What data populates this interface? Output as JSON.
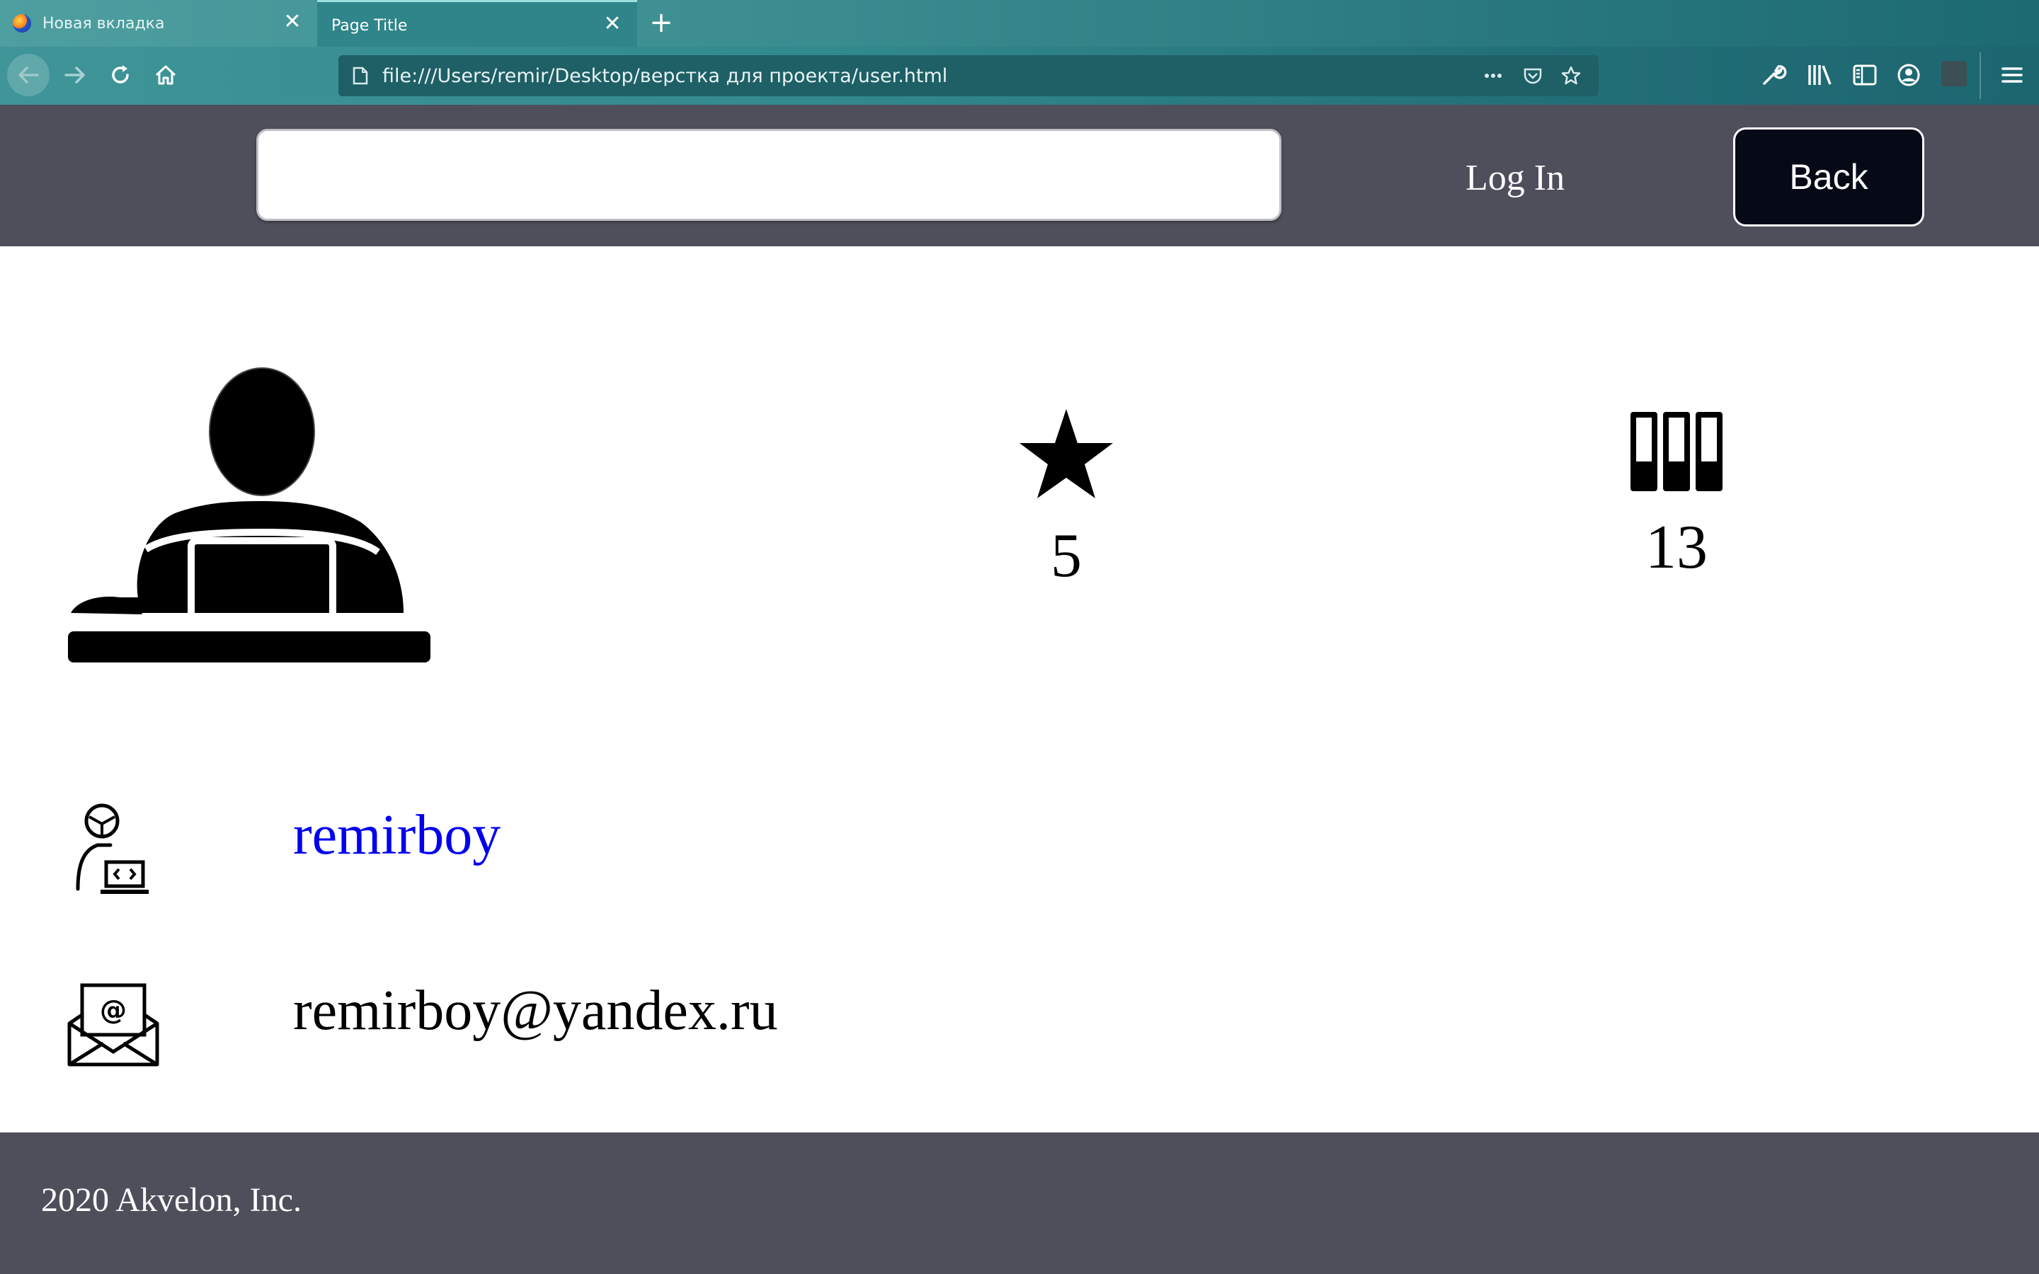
{
  "browser": {
    "tabs": [
      {
        "label": "Новая вкладка",
        "active": false
      },
      {
        "label": "Page Title",
        "active": true
      }
    ],
    "close_glyph": "✕",
    "new_tab_glyph": "+",
    "url": "file:///Users/remir/Desktop/верстка для проекта/user.html",
    "url_icons": [
      "page-options-icon",
      "pocket-icon",
      "bookmark-star-icon"
    ],
    "toolbar_icons": [
      "wrench-icon",
      "library-icon",
      "sidebar-icon",
      "account-icon",
      "extension-icon",
      "hamburger-menu-icon"
    ]
  },
  "header": {
    "search": {
      "value": "",
      "placeholder": ""
    },
    "login_label": "Log In",
    "back_label": "Back"
  },
  "profile": {
    "avatar_icon": "person-at-laptop-icon",
    "stars": {
      "icon": "star-icon",
      "count": "5"
    },
    "repos": {
      "icon": "repositories-icon",
      "count": "13"
    },
    "username": {
      "icon": "developer-icon",
      "text": "remirboy"
    },
    "email": {
      "icon": "email-envelope-icon",
      "text": "remirboy@yandex.ru"
    }
  },
  "footer": {
    "copyright": "2020 Akvelon, Inc."
  },
  "colors": {
    "header_bg": "#4e4f5b",
    "footer_bg": "#4e4f5b",
    "back_button_bg": "#050a16",
    "link": "#0000ee",
    "browser_teal": "#2f8589"
  }
}
